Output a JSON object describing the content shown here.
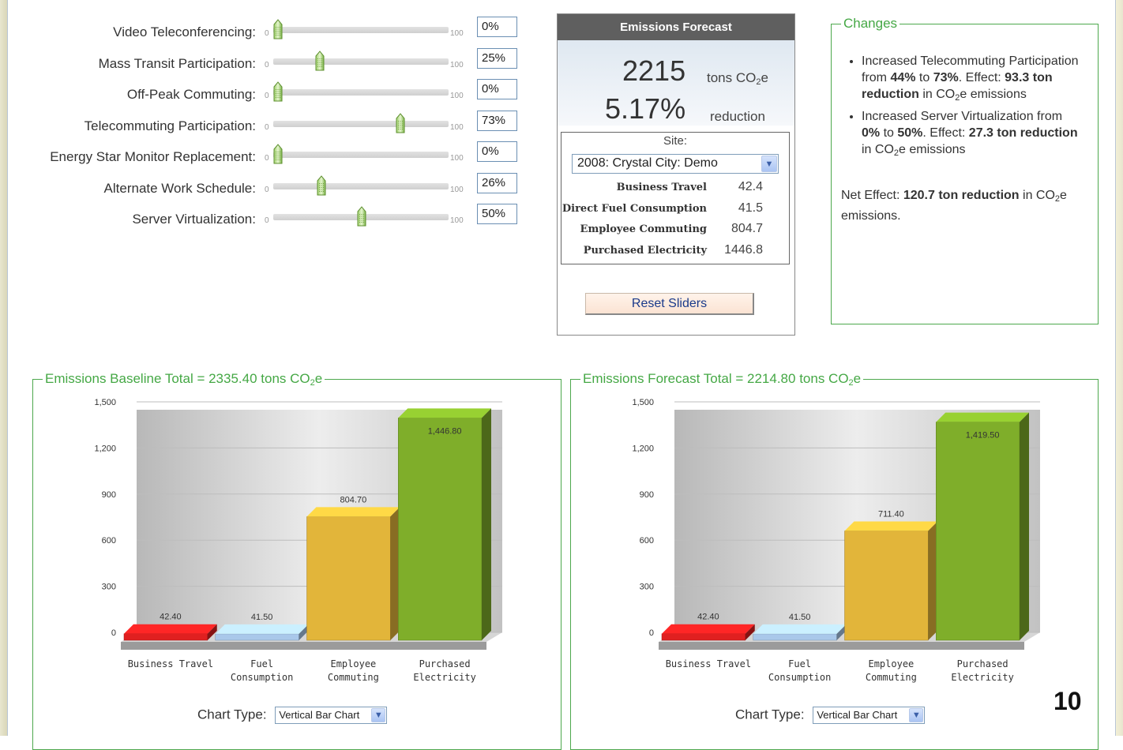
{
  "sliders": [
    {
      "label": "Video Teleconferencing:",
      "min": "0",
      "max": "100",
      "value_text": "0%",
      "value": 0
    },
    {
      "label": "Mass Transit Participation:",
      "min": "0",
      "max": "100",
      "value_text": "25%",
      "value": 25
    },
    {
      "label": "Off-Peak Commuting:",
      "min": "0",
      "max": "100",
      "value_text": "0%",
      "value": 0
    },
    {
      "label": "Telecommuting Participation:",
      "min": "0",
      "max": "100",
      "value_text": "73%",
      "value": 73
    },
    {
      "label": "Energy Star Monitor Replacement:",
      "min": "0",
      "max": "100",
      "value_text": "0%",
      "value": 0
    },
    {
      "label": "Alternate Work Schedule:",
      "min": "0",
      "max": "100",
      "value_text": "26%",
      "value": 26
    },
    {
      "label": "Server Virtualization:",
      "min": "0",
      "max": "100",
      "value_text": "50%",
      "value": 50
    }
  ],
  "forecast": {
    "title": "Emissions Forecast",
    "total": "2215",
    "total_unit": "tons CO",
    "total_unit_sub": "2",
    "total_unit_suffix": "e",
    "reduction": "5.17%",
    "reduction_label": "reduction",
    "site_label": "Site:",
    "site_value": "2008: Crystal City: Demo",
    "rows": [
      {
        "label": "Business Travel",
        "value": "42.4"
      },
      {
        "label": "Direct Fuel Consumption",
        "value": "41.5"
      },
      {
        "label": "Employee Commuting",
        "value": "804.7"
      },
      {
        "label": "Purchased Electricity",
        "value": "1446.8"
      }
    ],
    "reset_label": "Reset Sliders"
  },
  "changes": {
    "legend": "Changes",
    "item1": {
      "a": "Increased Telecommuting Participation from ",
      "b": "44%",
      "c": " to ",
      "d": "73%",
      "e": ". Effect: ",
      "f": "93.3 ton reduction",
      "g": " in CO",
      "h": "2",
      "i": "e emissions"
    },
    "item2": {
      "a": "Increased Server Virtualization from ",
      "b": "0%",
      "c": " to ",
      "d": "50%",
      "e": ". Effect: ",
      "f": "27.3 ton reduction",
      "g": " in CO",
      "h": "2",
      "i": "e emissions"
    },
    "net": {
      "a": "Net Effect: ",
      "b": "120.7 ton reduction",
      "c": " in CO",
      "d": "2",
      "e": "e emissions."
    }
  },
  "baseline_legend": {
    "prefix": "Emissions Baseline Total = 2335.40 tons CO",
    "sub": "2",
    "suffix": "e"
  },
  "forecast_legend": {
    "prefix": "Emissions Forecast Total = 2214.80 tons CO",
    "sub": "2",
    "suffix": "e"
  },
  "chart_type_label": "Chart Type:",
  "chart_type_value": "Vertical Bar Chart",
  "page_number": "10",
  "chart_data": [
    {
      "type": "bar",
      "title": "Emissions Baseline Total = 2335.40 tons CO2e",
      "categories": [
        [
          "Business Travel"
        ],
        [
          "Fuel",
          "Consumption"
        ],
        [
          "Employee",
          "Commuting"
        ],
        [
          "Purchased",
          "Electricity"
        ]
      ],
      "values": [
        42.4,
        41.5,
        804.7,
        1446.8
      ],
      "labels": [
        "42.40",
        "41.50",
        "804.70",
        "1,446.80"
      ],
      "yticks": [
        "0",
        "300",
        "600",
        "900",
        "1,200",
        "1,500"
      ],
      "ylim": [
        0,
        1500
      ],
      "colors": [
        "#e02020",
        "#a9c8ea",
        "#e2b53a",
        "#7fae2a"
      ],
      "grid": true
    },
    {
      "type": "bar",
      "title": "Emissions Forecast Total = 2214.80 tons CO2e",
      "categories": [
        [
          "Business Travel"
        ],
        [
          "Fuel",
          "Consumption"
        ],
        [
          "Employee",
          "Commuting"
        ],
        [
          "Purchased",
          "Electricity"
        ]
      ],
      "values": [
        42.4,
        41.5,
        711.4,
        1419.5
      ],
      "labels": [
        "42.40",
        "41.50",
        "711.40",
        "1,419.50"
      ],
      "yticks": [
        "0",
        "300",
        "600",
        "900",
        "1,200",
        "1,500"
      ],
      "ylim": [
        0,
        1500
      ],
      "colors": [
        "#e02020",
        "#a9c8ea",
        "#e2b53a",
        "#7fae2a"
      ],
      "grid": true
    }
  ]
}
